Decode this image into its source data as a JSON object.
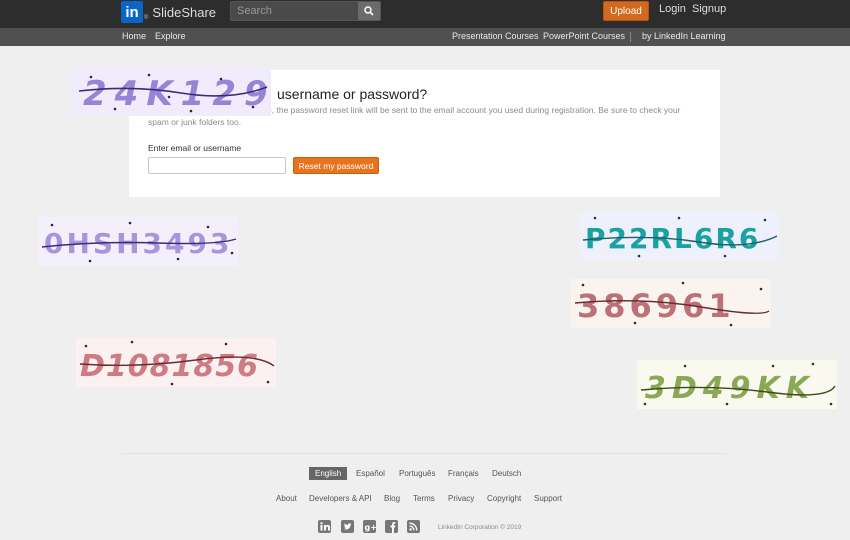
{
  "header": {
    "logo_mark": "in",
    "logo_reg": "®",
    "brand": "SlideShare",
    "search_placeholder": "Search",
    "upload_label": "Upload",
    "login_label": "Login",
    "signup_label": "Signup"
  },
  "subnav": {
    "home": "Home",
    "explore": "Explore",
    "presentation_courses": "Presentation Courses",
    "powerpoint_courses": "PowerPoint Courses",
    "linkedin_learning": "by LinkedIn Learning"
  },
  "card": {
    "title_visible": "username or password?",
    "description": "t link. If you enter your username, the password reset link will be sent to the email account you used during registration. Be sure to check your spam or junk folders too.",
    "email_label": "Enter email or username",
    "email_value": "",
    "reset_button": "Reset my password"
  },
  "captchas": [
    {
      "text": "24K129",
      "color": "#7b62c8"
    },
    {
      "text": "0HSH3493",
      "color": "#8a6fd0"
    },
    {
      "text": "P22RL6R6",
      "color": "#1aa2a2"
    },
    {
      "text": "386961",
      "color": "#b35a63"
    },
    {
      "text": "D1081856",
      "color": "#c0545e"
    },
    {
      "text": "3D49KK",
      "color": "#7a9a3c"
    }
  ],
  "footer": {
    "languages": [
      "English",
      "Español",
      "Português",
      "Français",
      "Deutsch"
    ],
    "active_language": "English",
    "links": [
      "About",
      "Developers & API",
      "Blog",
      "Terms",
      "Privacy",
      "Copyright",
      "Support"
    ],
    "social_icons": [
      "linkedin-icon",
      "twitter-icon",
      "google-plus-icon",
      "facebook-icon",
      "rss-icon"
    ],
    "copyright": "LinkedIn Corporation © 2019"
  }
}
